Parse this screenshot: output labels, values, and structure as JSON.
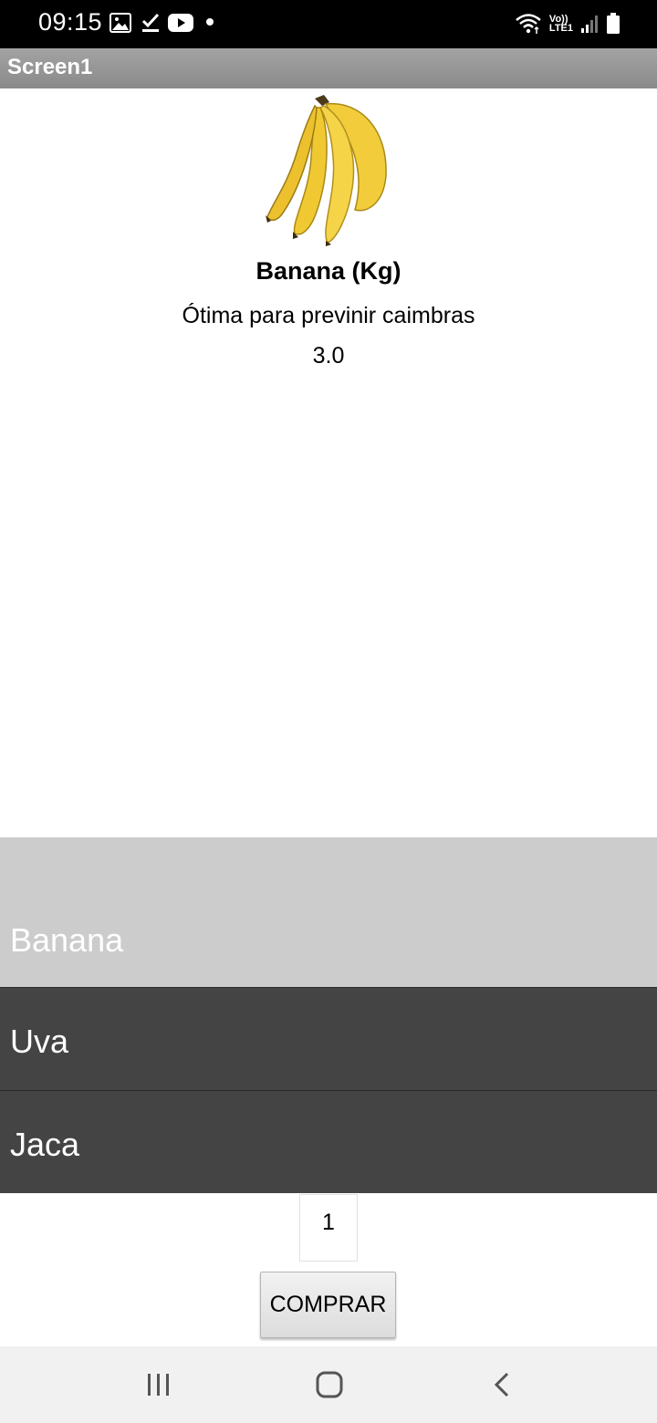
{
  "status_bar": {
    "time": "09:15",
    "left_icons": [
      "image-icon",
      "check-download-icon",
      "youtube-icon",
      "dot-icon"
    ],
    "right_icons": [
      "wifi-icon",
      "volte-lte-icon",
      "signal-icon",
      "battery-icon"
    ],
    "network_top": "Vo))",
    "network_bottom": "LTE1"
  },
  "title_bar": {
    "title": "Screen1"
  },
  "product": {
    "image": "banana-image",
    "name": "Banana (Kg)",
    "description": "Ótima para previnir caimbras",
    "price": "3.0"
  },
  "list": {
    "items": [
      {
        "label": "Banana",
        "selected": true
      },
      {
        "label": "Uva",
        "selected": false
      },
      {
        "label": "Jaca",
        "selected": false
      }
    ],
    "selected_color": "#cccccc",
    "item_color": "#444444"
  },
  "quantity": {
    "value": "1"
  },
  "buy_button": {
    "label": "COMPRAR"
  },
  "nav_bar": {
    "buttons": [
      "recent-apps-icon",
      "home-icon",
      "back-icon"
    ]
  }
}
